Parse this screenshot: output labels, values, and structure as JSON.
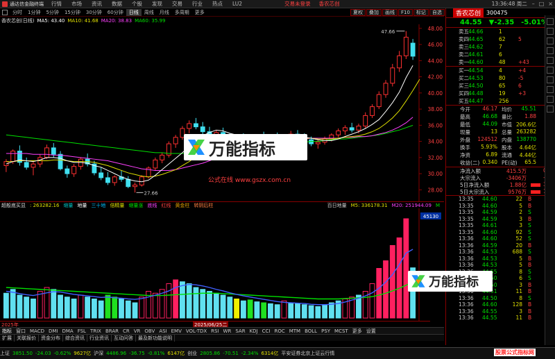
{
  "menubar": {
    "app_title": "通达信金融终端",
    "items": [
      "行情",
      "市场",
      "资讯",
      "数据",
      "个股",
      "发现",
      "交易",
      "行业",
      "热点",
      "LU2"
    ],
    "trade_links": [
      "交易未登录",
      "香农芯创"
    ],
    "clock": "13:36:48 周二"
  },
  "periods": {
    "items": [
      "分时",
      "1分钟",
      "5分钟",
      "15分钟",
      "30分钟",
      "60分钟",
      "日线",
      "周线",
      "月线",
      "多周期",
      "更多"
    ],
    "active": "日线"
  },
  "right_tabs": [
    "夏权",
    "叠加",
    "画线",
    "F10",
    "标记",
    "自选",
    "返回"
  ],
  "legend": {
    "stock_label": "香农芯创(日线)",
    "ma5": "MA5: 43.40",
    "ma10": "MA10: 41.68",
    "ma20": "MA20: 38.83",
    "ma60": "MA60: 35.99",
    "colors": {
      "ma5": "#ffffff",
      "ma10": "#e0e000",
      "ma20": "#ff40ff",
      "ma60": "#00e000"
    }
  },
  "indicator_header": {
    "name": "超般底买显",
    "value": ": 263282.16",
    "items": [
      {
        "label": "缩量",
        "color": "#00c0c0"
      },
      {
        "label": "地量",
        "color": "#ffffff"
      },
      {
        "label": "三十地",
        "color": "#00c0ff"
      },
      {
        "label": "倍精量",
        "color": "#e0e000"
      },
      {
        "label": "缩量涨",
        "color": "#00e000"
      },
      {
        "label": "底线",
        "color": "#ff40ff"
      },
      {
        "label": "红线",
        "color": "#ff4040"
      },
      {
        "label": "黄金柱",
        "color": "#e0a000"
      },
      {
        "label": "转阴后柱",
        "color": "#ff8040"
      }
    ],
    "right_items": [
      "百日地量",
      "M5: 336178.31",
      "M20: 251944.09",
      "M"
    ]
  },
  "annotations": {
    "high": "47.66",
    "low": "27.66",
    "sub_label": "45130"
  },
  "dates": {
    "start": "2025年",
    "mid": "2025/06/25二"
  },
  "indicator_tabs": [
    "指标",
    "窗口",
    "MACD",
    "DMI",
    "DMA",
    "FSL",
    "TRIX",
    "BRAR",
    "CR",
    "VR",
    "OBV",
    "ASI",
    "EMV",
    "VOL-TDX",
    "RSI",
    "WR",
    "SAR",
    "KDJ",
    "CCI",
    "ROC",
    "MTM",
    "BOLL",
    "PSY",
    "MCST",
    "更多",
    "设置"
  ],
  "info_tabs": [
    "扩展",
    "关联报价",
    "资金分布",
    "综合资讯",
    "行业资讯",
    "互动问答",
    "最及新功能说明"
  ],
  "right_panel": {
    "name": "香农芯创",
    "code": "300475",
    "price": "44.55",
    "change": "▼-2.35",
    "pct": "-5.01%",
    "asks": [
      {
        "label": "卖五",
        "price": "44.66",
        "vol": "1",
        "diff": ""
      },
      {
        "label": "卖四",
        "price": "44.65",
        "vol": "62",
        "diff": "5"
      },
      {
        "label": "卖三",
        "price": "44.62",
        "vol": "7",
        "diff": ""
      },
      {
        "label": "卖二",
        "price": "44.61",
        "vol": "6",
        "diff": ""
      },
      {
        "label": "卖一",
        "price": "44.60",
        "vol": "48",
        "diff": "+43"
      }
    ],
    "bids": [
      {
        "label": "买一",
        "price": "44.54",
        "vol": "4",
        "diff": "+4"
      },
      {
        "label": "买二",
        "price": "44.53",
        "vol": "80",
        "diff": "-5"
      },
      {
        "label": "买三",
        "price": "44.50",
        "vol": "65",
        "diff": "6"
      },
      {
        "label": "买四",
        "price": "44.48",
        "vol": "19",
        "diff": "+3"
      },
      {
        "label": "买五",
        "price": "44.47",
        "vol": "256",
        "diff": ""
      }
    ],
    "stats": [
      {
        "l1": "今开",
        "v1": "46.17",
        "c1": "#ff4040",
        "l2": "均价",
        "v2": "45.51",
        "c2": "#00e000"
      },
      {
        "l1": "最高",
        "v1": "46.68",
        "c1": "#00e000",
        "l2": "量比",
        "v2": "1.88",
        "c2": "#ff4040"
      },
      {
        "l1": "最低",
        "v1": "44.09",
        "c1": "#00e000",
        "l2": "市值",
        "v2": "206.6亿",
        "c2": "#e0e000"
      },
      {
        "l1": "现量",
        "v1": "13",
        "c1": "#e0e000",
        "l2": "总量",
        "v2": "263282",
        "c2": "#e0e000"
      },
      {
        "l1": "外盘",
        "v1": "124512",
        "c1": "#ff4040",
        "l2": "内盘",
        "v2": "138770",
        "c2": "#00e000"
      },
      {
        "l1": "换手",
        "v1": "5.93%",
        "c1": "#e0e000",
        "l2": "股本",
        "v2": "4.64亿",
        "c2": "#e0e000"
      },
      {
        "l1": "净资",
        "v1": "6.89",
        "c1": "#e0e000",
        "l2": "流通",
        "v2": "4.44亿",
        "c2": "#e0e000"
      },
      {
        "l1": "收益(二)",
        "v1": "0.340",
        "c1": "#e0e000",
        "l2": "PE(动)",
        "v2": "65.5",
        "c2": "#e0e000"
      }
    ],
    "flows": [
      {
        "label": "净流入额",
        "value": "415.5万",
        "pct": "0%",
        "bar_color": ""
      },
      {
        "label": "大宗流入",
        "value": "-3406万",
        "pct": "-1%",
        "bar_color": ""
      },
      {
        "label": "5日净流入额",
        "value": "1.88亿",
        "pct": "3%",
        "bar_color": "#ff2020"
      },
      {
        "label": "5日大宗流入",
        "value": "9576万",
        "pct": "1%",
        "bar_color": "#ff2020"
      }
    ],
    "ticks": [
      {
        "t": "13:35",
        "p": "44.60",
        "pc": "#00e000",
        "v": "22",
        "s": "B",
        "sc": "#ff4040"
      },
      {
        "t": "13:35",
        "p": "44.60",
        "pc": "#00e000",
        "v": "5",
        "s": "B",
        "sc": "#ff4040"
      },
      {
        "t": "13:35",
        "p": "44.59",
        "pc": "#00e000",
        "v": "2",
        "s": "S",
        "sc": "#00e000"
      },
      {
        "t": "13:35",
        "p": "44.59",
        "pc": "#00e000",
        "v": "3",
        "s": "B",
        "sc": "#ff4040"
      },
      {
        "t": "13:35",
        "p": "44.61",
        "pc": "#00e000",
        "v": "3",
        "s": "S",
        "sc": "#00e000"
      },
      {
        "t": "13:35",
        "p": "44.60",
        "pc": "#00e000",
        "v": "92",
        "s": "S",
        "sc": "#00e000"
      },
      {
        "t": "13:36",
        "p": "44.60",
        "pc": "#00e000",
        "v": "52",
        "s": "S",
        "sc": "#00e000"
      },
      {
        "t": "13:36",
        "p": "44.59",
        "pc": "#00e000",
        "v": "20",
        "s": "B",
        "sc": "#ff4040"
      },
      {
        "t": "13:36",
        "p": "44.53",
        "pc": "#00e000",
        "v": "688",
        "s": "S",
        "sc": "#00e000"
      },
      {
        "t": "13:36",
        "p": "44.53",
        "pc": "#00e000",
        "v": "5",
        "s": "B",
        "sc": "#ff4040"
      },
      {
        "t": "13:36",
        "p": "44.53",
        "pc": "#00e000",
        "v": "5",
        "s": "B",
        "sc": "#ff4040"
      },
      {
        "t": "13:36",
        "p": "44.55",
        "pc": "#00e000",
        "v": "8",
        "s": "S",
        "sc": "#00e000"
      },
      {
        "t": "13:36",
        "p": "44.50",
        "pc": "#00e000",
        "v": "6",
        "s": "S",
        "sc": "#00e000"
      },
      {
        "t": "13:36",
        "p": "44.50",
        "pc": "#00e000",
        "v": "3",
        "s": "B",
        "sc": "#ff4040"
      },
      {
        "t": "13:36",
        "p": "44.51",
        "pc": "#00e000",
        "v": "11",
        "s": "B",
        "sc": "#ff4040"
      },
      {
        "t": "13:36",
        "p": "44.50",
        "pc": "#00e000",
        "v": "8",
        "s": "S",
        "sc": "#00e000"
      },
      {
        "t": "13:36",
        "p": "44.60",
        "pc": "#00e000",
        "v": "128",
        "s": "B",
        "sc": "#ff4040"
      },
      {
        "t": "13:36",
        "p": "44.55",
        "pc": "#00e000",
        "v": "3",
        "s": "B",
        "sc": "#ff4040"
      },
      {
        "t": "13:36",
        "p": "44.55",
        "pc": "#00e000",
        "v": "11",
        "s": "B",
        "sc": "#ff4040"
      }
    ]
  },
  "statusbar": {
    "items": [
      {
        "text": "上证",
        "color": "#ccc"
      },
      {
        "text": "3851.50",
        "color": "#00e000"
      },
      {
        "text": "-24.03",
        "color": "#00e000"
      },
      {
        "text": "-0.62%",
        "color": "#00e000"
      },
      {
        "text": "9627亿",
        "color": "#e0e000"
      },
      {
        "text": "沪深",
        "color": "#ccc"
      },
      {
        "text": "4486.96",
        "color": "#00e000"
      },
      {
        "text": "-36.75",
        "color": "#00e000"
      },
      {
        "text": "-0.81%",
        "color": "#00e000"
      },
      {
        "text": "6147亿",
        "color": "#e0e000"
      },
      {
        "text": "创业",
        "color": "#ccc"
      },
      {
        "text": "2805.86",
        "color": "#00e000"
      },
      {
        "text": "-70.51",
        "color": "#00e000"
      },
      {
        "text": "-2.34%",
        "color": "#00e000"
      },
      {
        "text": "6314亿",
        "color": "#e0e000"
      },
      {
        "text": "平安证券北京上证云行情",
        "color": "#ccc"
      }
    ]
  },
  "watermarks": {
    "brand": "万能指标",
    "url": "公式在线 www.gszx.com.cn",
    "corner": "股票公式指标网"
  },
  "chart_data": {
    "type": "candlestick",
    "y_axis_ticks": [
      "48.00",
      "46.00",
      "44.00",
      "42.00",
      "40.00",
      "38.00",
      "36.00",
      "34.00",
      "32.00",
      "30.00",
      "28.00"
    ],
    "ylim": [
      27.0,
      48.5
    ],
    "candles": [
      [
        31.0,
        31.8,
        30.2,
        31.5
      ],
      [
        31.5,
        33.0,
        31.2,
        32.8
      ],
      [
        32.8,
        33.5,
        31.0,
        31.4
      ],
      [
        31.4,
        32.0,
        30.5,
        30.8
      ],
      [
        30.8,
        31.5,
        29.8,
        31.2
      ],
      [
        31.2,
        32.4,
        30.8,
        32.0
      ],
      [
        32.0,
        33.6,
        31.8,
        33.2
      ],
      [
        33.2,
        33.8,
        32.0,
        32.4
      ],
      [
        32.4,
        32.8,
        30.4,
        30.6
      ],
      [
        30.6,
        31.0,
        29.5,
        30.0
      ],
      [
        30.0,
        31.2,
        29.6,
        30.9
      ],
      [
        30.9,
        32.0,
        30.5,
        31.8
      ],
      [
        31.8,
        32.5,
        30.9,
        31.2
      ],
      [
        31.2,
        31.6,
        29.8,
        30.1
      ],
      [
        30.1,
        30.8,
        29.2,
        29.5
      ],
      [
        29.5,
        30.2,
        28.6,
        28.9
      ],
      [
        28.9,
        29.8,
        28.5,
        29.6
      ],
      [
        29.6,
        30.4,
        29.0,
        29.3
      ],
      [
        29.3,
        29.7,
        28.2,
        28.4
      ],
      [
        28.4,
        28.9,
        27.66,
        28.6
      ],
      [
        28.6,
        29.8,
        28.4,
        29.6
      ],
      [
        29.6,
        30.9,
        29.4,
        30.7
      ],
      [
        30.7,
        32.0,
        30.4,
        31.7
      ],
      [
        31.7,
        32.6,
        31.3,
        32.3
      ],
      [
        32.3,
        34.0,
        32.0,
        33.7
      ],
      [
        33.7,
        34.8,
        33.2,
        34.5
      ],
      [
        34.5,
        35.9,
        34.2,
        35.6
      ],
      [
        35.6,
        36.6,
        35.0,
        36.2
      ],
      [
        36.2,
        36.9,
        35.5,
        35.8
      ],
      [
        35.8,
        36.4,
        34.9,
        35.2
      ],
      [
        35.2,
        35.8,
        34.4,
        34.7
      ],
      [
        34.7,
        35.4,
        34.1,
        35.1
      ],
      [
        35.1,
        35.7,
        34.3,
        34.6
      ],
      [
        34.6,
        35.0,
        33.8,
        34.1
      ],
      [
        34.1,
        34.8,
        33.5,
        34.5
      ],
      [
        34.5,
        35.0,
        33.9,
        34.2
      ],
      [
        34.2,
        34.7,
        33.6,
        34.0
      ],
      [
        34.0,
        34.9,
        33.7,
        34.6
      ],
      [
        34.6,
        35.2,
        34.0,
        34.3
      ],
      [
        34.3,
        34.8,
        33.8,
        34.5
      ],
      [
        34.5,
        35.1,
        34.0,
        34.3
      ],
      [
        34.3,
        34.9,
        33.8,
        34.6
      ],
      [
        34.6,
        35.3,
        34.2,
        34.9
      ],
      [
        34.9,
        35.4,
        34.3,
        34.5
      ],
      [
        34.5,
        35.0,
        33.9,
        34.2
      ],
      [
        34.2,
        34.6,
        33.4,
        33.7
      ],
      [
        33.7,
        34.2,
        33.1,
        33.9
      ],
      [
        33.9,
        34.6,
        33.6,
        34.3
      ],
      [
        34.3,
        35.0,
        34.0,
        34.8
      ],
      [
        34.8,
        35.6,
        34.5,
        35.3
      ],
      [
        35.3,
        36.0,
        34.8,
        35.7
      ],
      [
        35.7,
        36.3,
        35.1,
        35.4
      ],
      [
        35.4,
        36.2,
        35.0,
        35.9
      ],
      [
        35.9,
        37.6,
        35.6,
        37.2
      ],
      [
        37.2,
        38.6,
        36.9,
        38.3
      ],
      [
        38.3,
        40.2,
        38.0,
        39.8
      ],
      [
        39.8,
        41.6,
        39.4,
        41.2
      ],
      [
        41.2,
        43.6,
        40.8,
        43.1
      ],
      [
        43.1,
        45.2,
        42.6,
        44.6
      ],
      [
        44.6,
        47.66,
        44.2,
        46.9
      ],
      [
        46.17,
        46.68,
        44.09,
        44.55
      ]
    ],
    "ma5": [
      31.2,
      31.5,
      31.7,
      31.6,
      31.5,
      31.7,
      32.0,
      32.0,
      31.9,
      31.6,
      31.4,
      31.4,
      31.3,
      31.0,
      30.8,
      30.4,
      30.0,
      29.6,
      29.3,
      29.1,
      29.0,
      29.2,
      29.8,
      30.5,
      31.2,
      31.9,
      32.6,
      33.4,
      34.2,
      34.7,
      35.1,
      35.4,
      35.3,
      35.0,
      34.8,
      34.6,
      34.4,
      34.3,
      34.3,
      34.3,
      34.3,
      34.4,
      34.5,
      34.5,
      34.5,
      34.4,
      34.2,
      34.1,
      34.1,
      34.3,
      34.6,
      34.9,
      35.2,
      35.6,
      36.1,
      36.7,
      37.7,
      38.8,
      40.1,
      41.9,
      43.4
    ],
    "ma10": [
      31.5,
      31.5,
      31.6,
      31.6,
      31.6,
      31.6,
      31.6,
      31.7,
      31.7,
      31.6,
      31.5,
      31.5,
      31.5,
      31.4,
      31.2,
      31.0,
      30.7,
      30.4,
      30.1,
      29.9,
      29.7,
      29.6,
      29.7,
      29.9,
      30.2,
      30.5,
      31.0,
      31.5,
      32.1,
      32.7,
      33.2,
      33.7,
      34.0,
      34.3,
      34.5,
      34.6,
      34.6,
      34.6,
      34.6,
      34.6,
      34.5,
      34.5,
      34.4,
      34.4,
      34.4,
      34.4,
      34.3,
      34.3,
      34.3,
      34.4,
      34.5,
      34.6,
      34.7,
      34.9,
      35.2,
      35.6,
      36.2,
      36.9,
      37.8,
      39.0,
      40.3,
      41.68
    ],
    "ma20": [
      32.5,
      32.5,
      32.5,
      32.5,
      32.4,
      32.4,
      32.4,
      32.3,
      32.3,
      32.2,
      32.1,
      32.0,
      31.9,
      31.8,
      31.7,
      31.6,
      31.4,
      31.2,
      31.0,
      30.8,
      30.6,
      30.5,
      30.4,
      30.4,
      30.4,
      30.5,
      30.7,
      30.9,
      31.1,
      31.3,
      31.6,
      31.9,
      32.2,
      32.5,
      32.8,
      33.1,
      33.3,
      33.5,
      33.7,
      33.8,
      34.0,
      34.1,
      34.2,
      34.3,
      34.3,
      34.4,
      34.4,
      34.4,
      34.4,
      34.4,
      34.5,
      34.5,
      34.6,
      34.6,
      34.7,
      34.9,
      35.1,
      35.4,
      35.8,
      36.3,
      37.0
    ],
    "ma60": [
      34.8,
      34.7,
      34.6,
      34.5,
      34.4,
      34.3,
      34.2,
      34.1,
      34.0,
      33.9,
      33.8,
      33.7,
      33.6,
      33.5,
      33.4,
      33.3,
      33.2,
      33.1,
      33.0,
      32.9,
      32.8,
      32.7,
      32.6,
      32.6,
      32.5,
      32.5,
      32.5,
      32.5,
      32.5,
      32.6,
      32.6,
      32.7,
      32.8,
      32.9,
      33.0,
      33.1,
      33.2,
      33.3,
      33.4,
      33.5,
      33.6,
      33.7,
      33.7,
      33.8,
      33.9,
      34.0,
      34.0,
      34.1,
      34.2,
      34.3,
      34.3,
      34.4,
      34.5,
      34.6,
      34.7,
      34.8,
      35.0,
      35.2,
      35.4,
      35.7,
      35.99
    ],
    "volumes": [
      130,
      150,
      120,
      110,
      100,
      140,
      160,
      150,
      120,
      110,
      100,
      120,
      110,
      100,
      90,
      120,
      110,
      100,
      90,
      80,
      110,
      140,
      130,
      150,
      180,
      200,
      190,
      180,
      160,
      150,
      140,
      130,
      120,
      110,
      100,
      90,
      95,
      85,
      80,
      75,
      70,
      90,
      80,
      75,
      70,
      65,
      60,
      70,
      80,
      90,
      100,
      110,
      120,
      140,
      180,
      260,
      300,
      380,
      420,
      520,
      263
    ],
    "vol_colors": [
      "c",
      "c",
      "c",
      "c",
      "c",
      "r",
      "r",
      "c",
      "c",
      "c",
      "c",
      "r",
      "c",
      "c",
      "c",
      "g",
      "g",
      "c",
      "c",
      "c",
      "r",
      "r",
      "r",
      "r",
      "r",
      "r",
      "c",
      "c",
      "c",
      "c",
      "c",
      "c",
      "c",
      "c",
      "y",
      "c",
      "g",
      "c",
      "g",
      "c",
      "c",
      "r",
      "c",
      "c",
      "c",
      "c",
      "c",
      "c",
      "c",
      "c",
      "r",
      "r",
      "c",
      "r",
      "r",
      "r",
      "r",
      "r",
      "r",
      "r",
      "c"
    ],
    "vol_ma5": [
      140,
      135,
      128,
      122,
      118,
      125,
      132,
      138,
      136,
      130,
      124,
      120,
      116,
      112,
      108,
      110,
      106,
      104,
      100,
      98,
      102,
      110,
      120,
      130,
      142,
      160,
      170,
      176,
      174,
      168,
      160,
      150,
      142,
      132,
      124,
      116,
      110,
      104,
      98,
      92,
      86,
      82,
      80,
      78,
      76,
      72,
      70,
      70,
      72,
      76,
      84,
      94,
      104,
      116,
      132,
      156,
      188,
      228,
      280,
      340,
      360
    ],
    "vol_ma20": [
      160,
      158,
      156,
      154,
      152,
      150,
      148,
      146,
      144,
      142,
      140,
      138,
      136,
      134,
      132,
      130,
      128,
      126,
      124,
      122,
      120,
      118,
      118,
      118,
      120,
      122,
      124,
      126,
      128,
      130,
      130,
      130,
      128,
      126,
      124,
      122,
      120,
      118,
      116,
      114,
      112,
      110,
      108,
      106,
      104,
      102,
      100,
      100,
      100,
      100,
      102,
      104,
      106,
      108,
      112,
      120,
      130,
      142,
      156,
      172,
      190
    ],
    "vol_ylim": [
      0,
      560
    ]
  }
}
